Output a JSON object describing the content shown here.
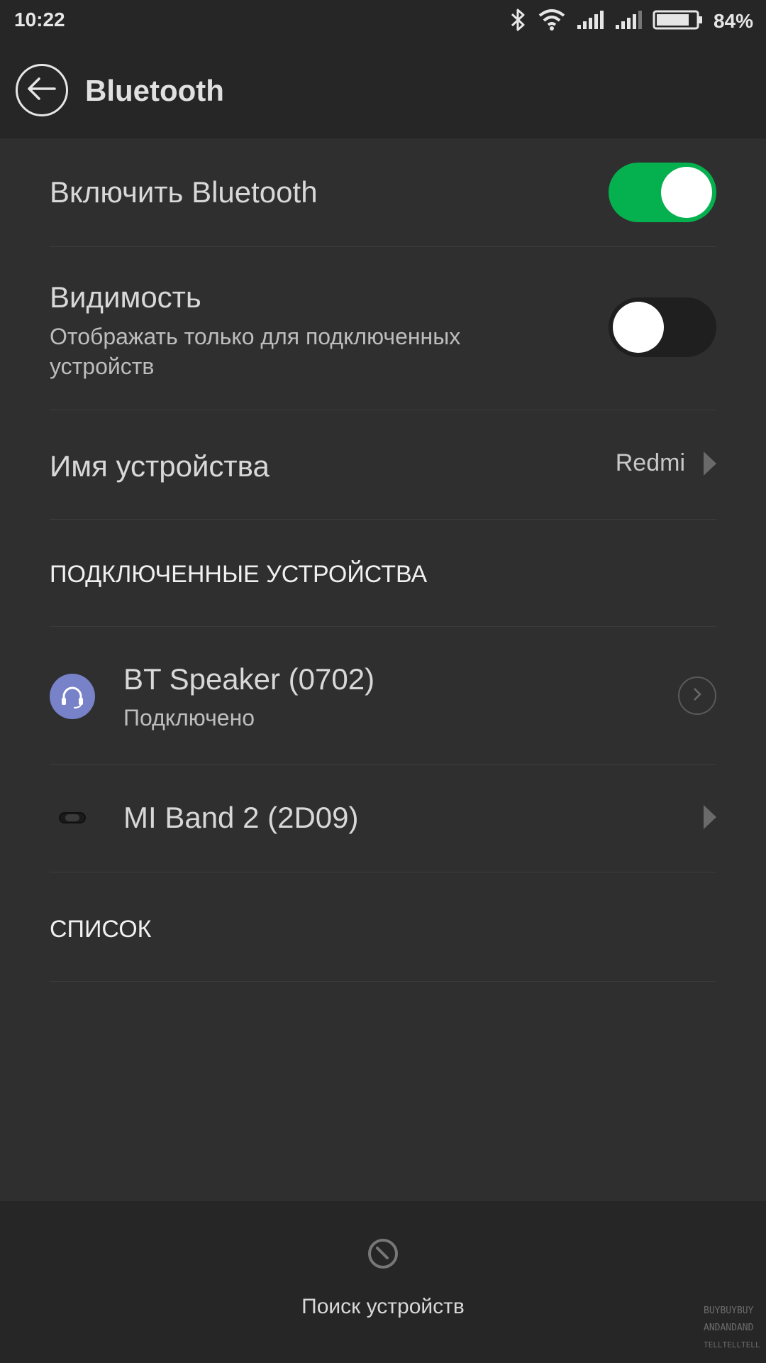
{
  "status_bar": {
    "time": "10:22",
    "battery_percent": "84%",
    "battery_level": 0.84,
    "icons": [
      "bluetooth-icon",
      "wifi-icon",
      "signal-icon",
      "signal-icon",
      "battery-icon"
    ]
  },
  "app_bar": {
    "title": "Bluetooth",
    "back_icon": "arrow-left-icon"
  },
  "settings": {
    "enable_bluetooth": {
      "label": "Включить Bluetooth",
      "on": true
    },
    "visibility": {
      "label": "Видимость",
      "subtitle": "Отображать только для подключенных устройств",
      "on": false
    },
    "device_name": {
      "label": "Имя устройства",
      "value": "Redmi"
    }
  },
  "paired": {
    "header": "ПОДКЛЮЧЕННЫЕ УСТРОЙСТВА",
    "devices": [
      {
        "name": "BT Speaker (0702)",
        "status": "Подключено",
        "icon": "headset-icon"
      },
      {
        "name": "MI Band 2 (2D09)",
        "status": "",
        "icon": "band-icon"
      }
    ]
  },
  "available": {
    "header": "СПИСОК"
  },
  "bottom": {
    "search_label": "Поиск устройств",
    "search_icon": "search-device-icon"
  },
  "watermark_text": "BUY BUY BUY AND AND AND TELLTELLTELL",
  "colors": {
    "toggle_on": "#05b14f",
    "headset_badge": "#7782c8",
    "background": "#2f2f2f",
    "bar_background": "#262626"
  }
}
